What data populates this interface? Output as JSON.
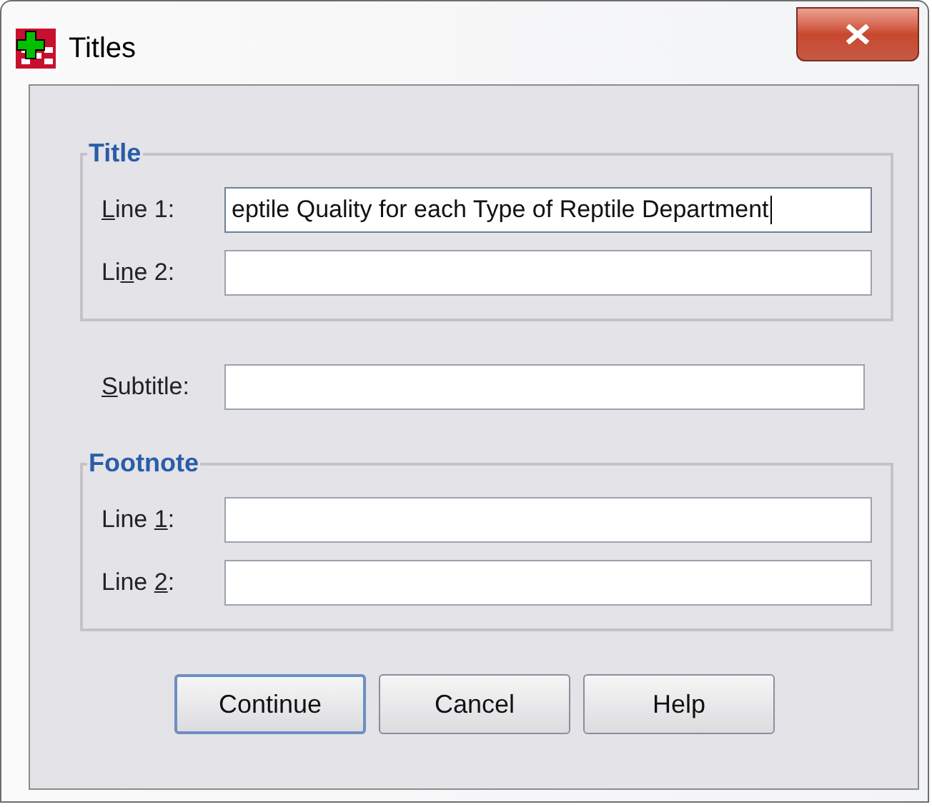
{
  "window": {
    "title": "Titles"
  },
  "groups": [
    {
      "kind": "group",
      "legend": "Title",
      "fields": [
        {
          "label": {
            "key": "L",
            "after": "ine 1:"
          },
          "value": "eptile Quality for each Type of Reptile Department",
          "focused": true
        },
        {
          "label": {
            "before": "Li",
            "key": "n",
            "after": "e 2:"
          },
          "focused": false
        }
      ]
    },
    {
      "kind": "plain",
      "fields": [
        {
          "label": {
            "key": "S",
            "after": "ubtitle:"
          },
          "focused": false
        }
      ]
    },
    {
      "kind": "group",
      "legend": "Footnote",
      "fields": [
        {
          "label": {
            "before": "Line ",
            "key": "1",
            "after": ":"
          },
          "focused": false
        },
        {
          "label": {
            "before": "Line ",
            "key": "2",
            "after": ":"
          },
          "focused": false
        }
      ]
    }
  ],
  "buttons": [
    {
      "label": "Continue",
      "default": true
    },
    {
      "label": "Cancel",
      "default": false
    },
    {
      "label": "Help",
      "default": false
    }
  ]
}
